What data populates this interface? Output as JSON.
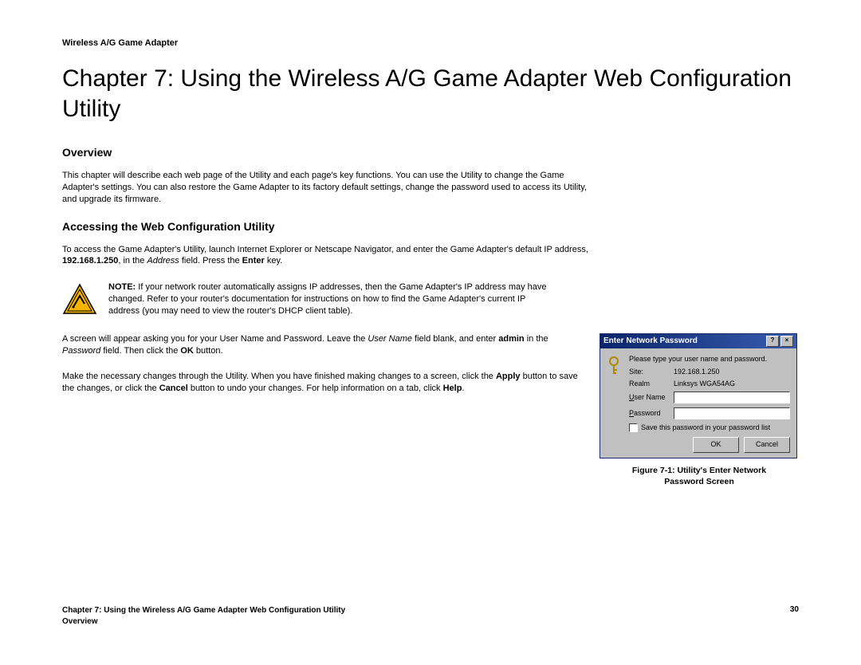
{
  "header": {
    "product": "Wireless A/G Game Adapter"
  },
  "chapter": {
    "title": "Chapter 7: Using the Wireless A/G Game Adapter Web Configuration Utility"
  },
  "overview": {
    "heading": "Overview",
    "para1": "This chapter will describe each web page of the Utility and each page's key functions. You can use the Utility to change the Game Adapter's settings. You can also restore the Game Adapter to its factory default settings, change the password used to access its Utility, and upgrade its firmware."
  },
  "accessing": {
    "heading": "Accessing the Web Configuration Utility",
    "para1_pre": "To access the Game Adapter's Utility, launch Internet Explorer or Netscape Navigator, and enter the Game Adapter's default IP address, ",
    "ip": "192.168.1.250",
    "para1_mid": ", in the ",
    "addr_field": "Address",
    "para1_post": " field. Press the ",
    "enter": "Enter",
    "para1_end": " key.",
    "note_label": "NOTE:",
    "note_body": " If your network router automatically assigns IP addresses, then the Game Adapter's IP address may have changed. Refer to your router's documentation for instructions on how to find the Game Adapter's current IP address (you may need to view the router's DHCP client table).",
    "para2_pre": "A screen will appear asking you for your User Name and Password. Leave the ",
    "user_name_i": "User Name",
    "para2_mid1": " field blank, and enter ",
    "admin_b": "admin",
    "para2_mid2": " in the ",
    "password_i": "Password",
    "para2_mid3": " field. Then click the ",
    "ok_b": "OK",
    "para2_end": " button.",
    "para3_pre": "Make the necessary changes through the Utility. When you have finished making changes to a screen, click the ",
    "apply_b": "Apply",
    "para3_mid1": " button to save the changes, or click the ",
    "cancel_b": "Cancel",
    "para3_mid2": " button to undo your changes. For help information on a tab, click ",
    "help_b": "Help",
    "para3_end": "."
  },
  "dialog": {
    "title": "Enter Network Password",
    "message": "Please type your user name and password.",
    "site_label": "Site:",
    "site_value": "192.168.1.250",
    "realm_label": "Realm",
    "realm_value": "Linksys WGA54AG",
    "username_label_u": "U",
    "username_label_rest": "ser Name",
    "password_label_u": "P",
    "password_label_rest": "assword",
    "save_u": "S",
    "save_rest": "ave this password in your password list",
    "ok": "OK",
    "cancel": "Cancel",
    "help_btn": "?",
    "close_btn": "×"
  },
  "figure": {
    "caption_line1": "Figure 7-1: Utility's Enter Network",
    "caption_line2": "Password Screen"
  },
  "footer": {
    "chapter": "Chapter 7: Using the Wireless A/G Game Adapter Web Configuration Utility",
    "section": "Overview",
    "page": "30"
  }
}
